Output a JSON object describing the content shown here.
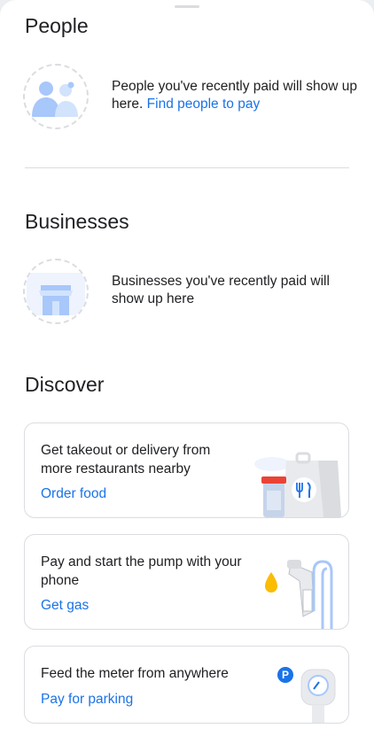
{
  "people": {
    "title": "People",
    "empty_text": "People you've recently paid will show up here.",
    "link": "Find people to pay"
  },
  "businesses": {
    "title": "Businesses",
    "empty_text": "Businesses you've recently paid will show up here"
  },
  "discover": {
    "title": "Discover",
    "cards": [
      {
        "text": "Get takeout or delivery from more restaurants nearby",
        "link": "Order food"
      },
      {
        "text": "Pay and start the pump with your phone",
        "link": "Get gas"
      },
      {
        "text": "Feed the meter from anywhere",
        "link": "Pay for parking",
        "badge": "P"
      }
    ]
  },
  "colors": {
    "accent": "#1a73e8",
    "illustration_blue": "#a8c7fa",
    "illustration_light": "#d2e3fc",
    "fuel_drop": "#fbbc04",
    "cup_red": "#ea4335"
  },
  "icons": [
    "people-illustration",
    "storefront-illustration",
    "food-bag-illustration",
    "gas-pump-illustration",
    "parking-meter-illustration"
  ]
}
